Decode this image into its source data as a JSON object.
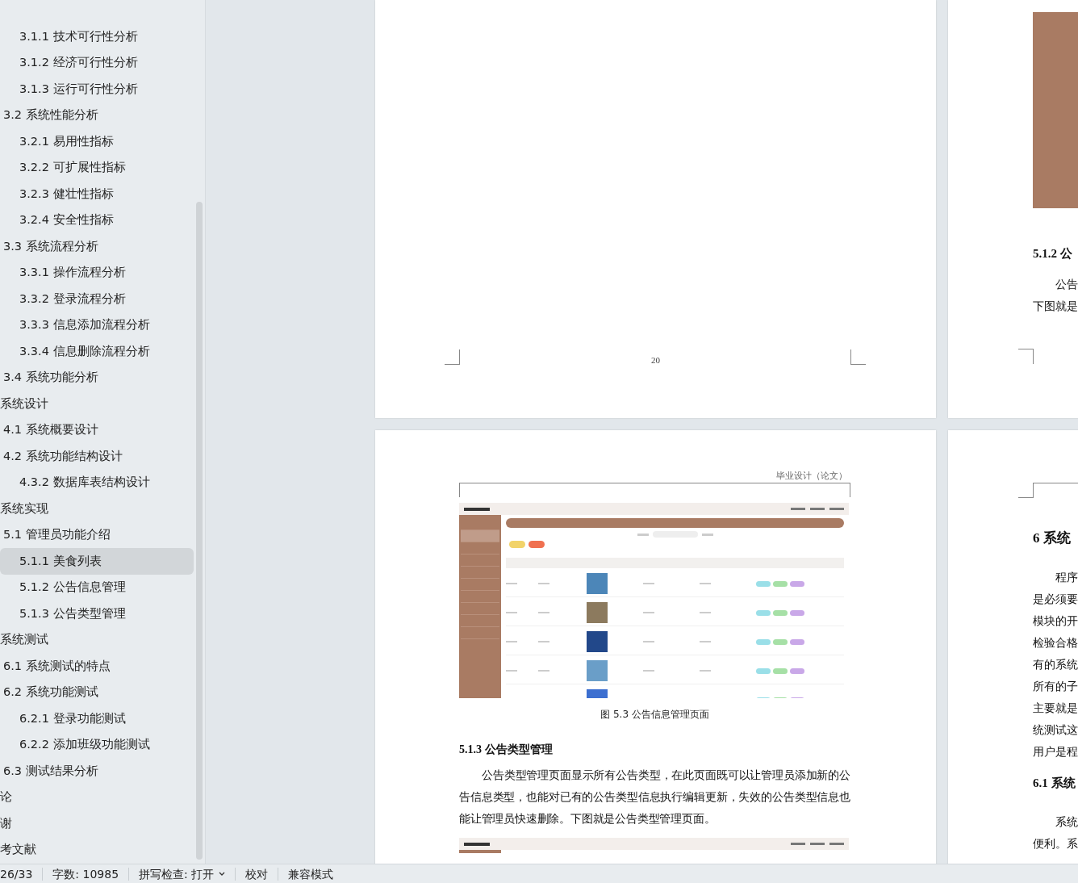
{
  "outline": {
    "items": [
      {
        "children": [
          {
            "children": [
              {
                "label": "3.1.1  技术可行性分析",
                "selected": false
              },
              {
                "label": "3.1.2  经济可行性分析",
                "selected": false
              },
              {
                "label": "3.1.3  运行可行性分析",
                "selected": false
              }
            ]
          },
          {
            "label": "3.2  系统性能分析",
            "selected": false,
            "children": [
              {
                "label": "3.2.1  易用性指标",
                "selected": false
              },
              {
                "label": "3.2.2  可扩展性指标",
                "selected": false
              },
              {
                "label": "3.2.3  健壮性指标",
                "selected": false
              },
              {
                "label": "3.2.4  安全性指标",
                "selected": false
              }
            ]
          },
          {
            "label": "3.3  系统流程分析",
            "selected": false,
            "children": [
              {
                "label": "3.3.1  操作流程分析",
                "selected": false
              },
              {
                "label": "3.3.2  登录流程分析",
                "selected": false
              },
              {
                "label": "3.3.3  信息添加流程分析",
                "selected": false
              },
              {
                "label": "3.3.4  信息删除流程分析",
                "selected": false
              }
            ]
          },
          {
            "label": "3.4  系统功能分析",
            "selected": false
          }
        ]
      },
      {
        "label": "系统设计",
        "selected": false,
        "children": [
          {
            "label": "4.1  系统概要设计",
            "selected": false
          },
          {
            "label": "4.2  系统功能结构设计",
            "selected": false,
            "children": [
              {
                "label": "4.3.2  数据库表结构设计",
                "selected": false
              }
            ]
          }
        ]
      },
      {
        "label": "系统实现",
        "selected": false,
        "children": [
          {
            "label": "5.1  管理员功能介绍",
            "selected": false,
            "children": [
              {
                "label": "5.1.1  美食列表",
                "selected": true
              },
              {
                "label": "5.1.2  公告信息管理",
                "selected": false
              },
              {
                "label": "5.1.3 公告类型管理",
                "selected": false
              }
            ]
          }
        ]
      },
      {
        "label": "系统测试",
        "selected": false,
        "children": [
          {
            "label": "6.1  系统测试的特点",
            "selected": false
          },
          {
            "label": "6.2  系统功能测试",
            "selected": false,
            "children": [
              {
                "label": "6.2.1  登录功能测试",
                "selected": false
              },
              {
                "label": "6.2.2  添加班级功能测试",
                "selected": false
              }
            ]
          },
          {
            "label": "6.3  测试结果分析",
            "selected": false
          }
        ]
      },
      {
        "label": "论",
        "selected": false
      },
      {
        "label": "谢",
        "selected": false
      },
      {
        "label": "考文献",
        "selected": false
      }
    ]
  },
  "document": {
    "page_upper": {
      "page_number": "20"
    },
    "page_lower": {
      "header": "毕业设计（论文）",
      "figure_caption": "图 5.3  公告信息管理页面",
      "heading": "5.1.3 公告类型管理",
      "paragraph": "公告类型管理页面显示所有公告类型，在此页面既可以让管理员添加新的公告信息类型，也能对已有的公告类型信息执行编辑更新，失效的公告类型信息也能让管理员快速删除。下图就是公告类型管理页面。"
    },
    "right_upper": {
      "heading": "5.1.2  公",
      "paragraphs": [
        [
          "公告",
          "下图就是"
        ]
      ]
    },
    "right_lower": {
      "heading": "6  系统",
      "paragraphs": [
        [
          "程序",
          "是必须要",
          "模块的开",
          "检验合格",
          "有的系统",
          "所有的子",
          "主要就是",
          "统测试这",
          "用户是程"
        ]
      ],
      "subheading": "6.1  系统",
      "paragraphs_2": [
        [
          "系统",
          "便利。系"
        ]
      ]
    }
  },
  "status_bar": {
    "page": "26/33",
    "word_count": "字数: 10985",
    "spell_check": "拼写检查: 打开",
    "proofread": "校对",
    "compat_mode": "兼容模式"
  }
}
